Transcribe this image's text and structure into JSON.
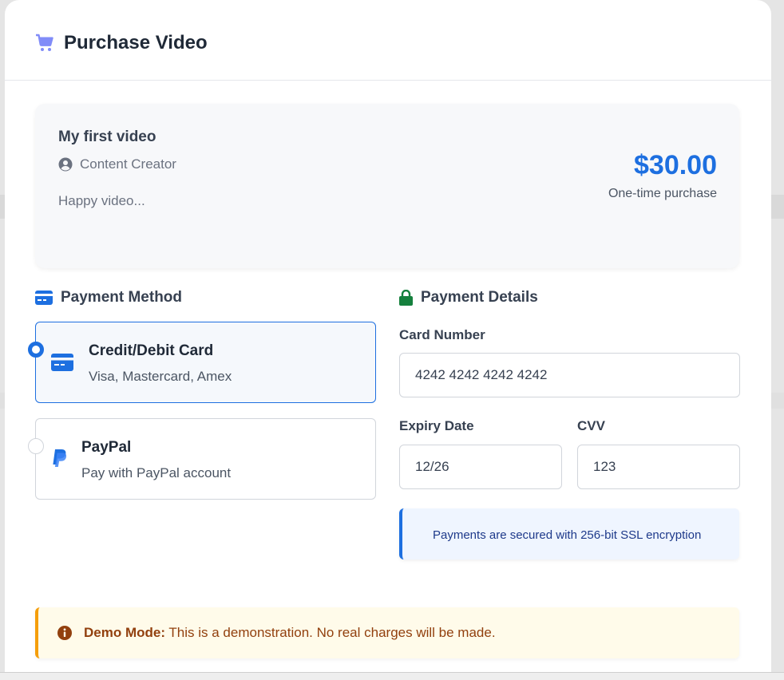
{
  "modal": {
    "title": "Purchase Video"
  },
  "video": {
    "title": "My first video",
    "creator": "Content Creator",
    "description": "Happy video...",
    "price": "$30.00",
    "price_note": "One-time purchase"
  },
  "payment_method": {
    "heading": "Payment Method",
    "options": [
      {
        "label": "Credit/Debit Card",
        "sub": "Visa, Mastercard, Amex",
        "selected": true,
        "icon": "credit-card-icon"
      },
      {
        "label": "PayPal",
        "sub": "Pay with PayPal account",
        "selected": false,
        "icon": "paypal-icon"
      }
    ]
  },
  "payment_details": {
    "heading": "Payment Details",
    "card_number_label": "Card Number",
    "card_number_value": "4242 4242 4242 4242",
    "expiry_label": "Expiry Date",
    "expiry_value": "12/26",
    "cvv_label": "CVV",
    "cvv_value": "123",
    "secure_note": "Payments are secured with 256-bit SSL encryption"
  },
  "demo": {
    "strong": "Demo Mode:",
    "text": " This is a demonstration. No real charges will be made."
  },
  "colors": {
    "accent": "#1d6fe0",
    "cart_icon": "#818cf8",
    "lock_icon": "#15803d",
    "warning": "#f59e0b"
  }
}
